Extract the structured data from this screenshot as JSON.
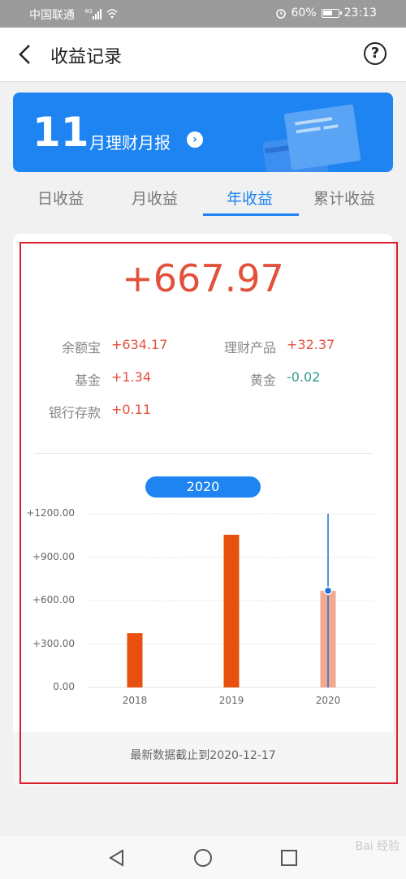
{
  "status_bar": {
    "carrier": "中国联通",
    "network": "4G",
    "battery": "60%",
    "time": "23:13"
  },
  "navbar": {
    "title": "收益记录"
  },
  "banner": {
    "month": "11",
    "label": "月理财月报"
  },
  "tabs": [
    {
      "label": "日收益"
    },
    {
      "label": "月收益"
    },
    {
      "label": "年收益"
    },
    {
      "label": "累计收益"
    }
  ],
  "active_tab": "年收益",
  "summary": {
    "total": "+667.97",
    "items": [
      {
        "label": "余额宝",
        "value": "+634.17"
      },
      {
        "label": "理财产品",
        "value": "+32.37"
      },
      {
        "label": "基金",
        "value": "+1.34"
      },
      {
        "label": "黄金",
        "value": "-0.02"
      },
      {
        "label": "银行存款",
        "value": "+0.11"
      }
    ]
  },
  "selected_year": "2020",
  "chart_data": {
    "type": "bar",
    "categories": [
      "2018",
      "2019",
      "2020"
    ],
    "values": [
      375,
      1055,
      667.97
    ],
    "ylim": [
      0,
      1200
    ],
    "yticks": [
      "0.00",
      "+300.00",
      "+600.00",
      "+900.00",
      "+1200.00"
    ],
    "highlighted": "2020",
    "colors": {
      "bar": "#e8500f",
      "highlight": "#f2a98f",
      "marker": "#1d6fcf"
    }
  },
  "footer_note": "最新数据截止到2020-12-17",
  "watermark": "Bai 经验"
}
